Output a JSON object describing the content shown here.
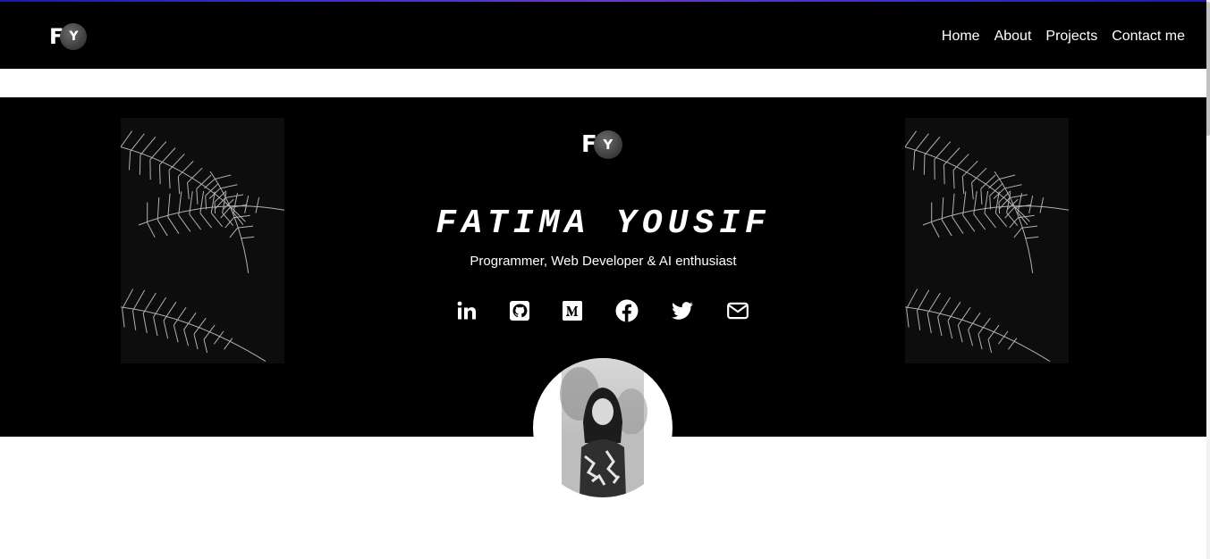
{
  "logo": {
    "letter_f": "F",
    "letter_y": "Y"
  },
  "nav": {
    "items": [
      {
        "label": "Home"
      },
      {
        "label": "About"
      },
      {
        "label": "Projects"
      },
      {
        "label": "Contact me"
      }
    ]
  },
  "hero": {
    "logo": {
      "letter_f": "F",
      "letter_y": "Y"
    },
    "name": "FATIMA YOUSIF",
    "tagline": "Programmer, Web Developer & AI enthusiast",
    "socials": [
      {
        "icon": "linkedin-icon"
      },
      {
        "icon": "github-icon"
      },
      {
        "icon": "medium-icon"
      },
      {
        "icon": "facebook-icon"
      },
      {
        "icon": "twitter-icon"
      },
      {
        "icon": "mail-icon"
      }
    ]
  },
  "colors": {
    "background": "#000000",
    "text": "#ffffff",
    "top_accent": "#3b2fd0"
  }
}
